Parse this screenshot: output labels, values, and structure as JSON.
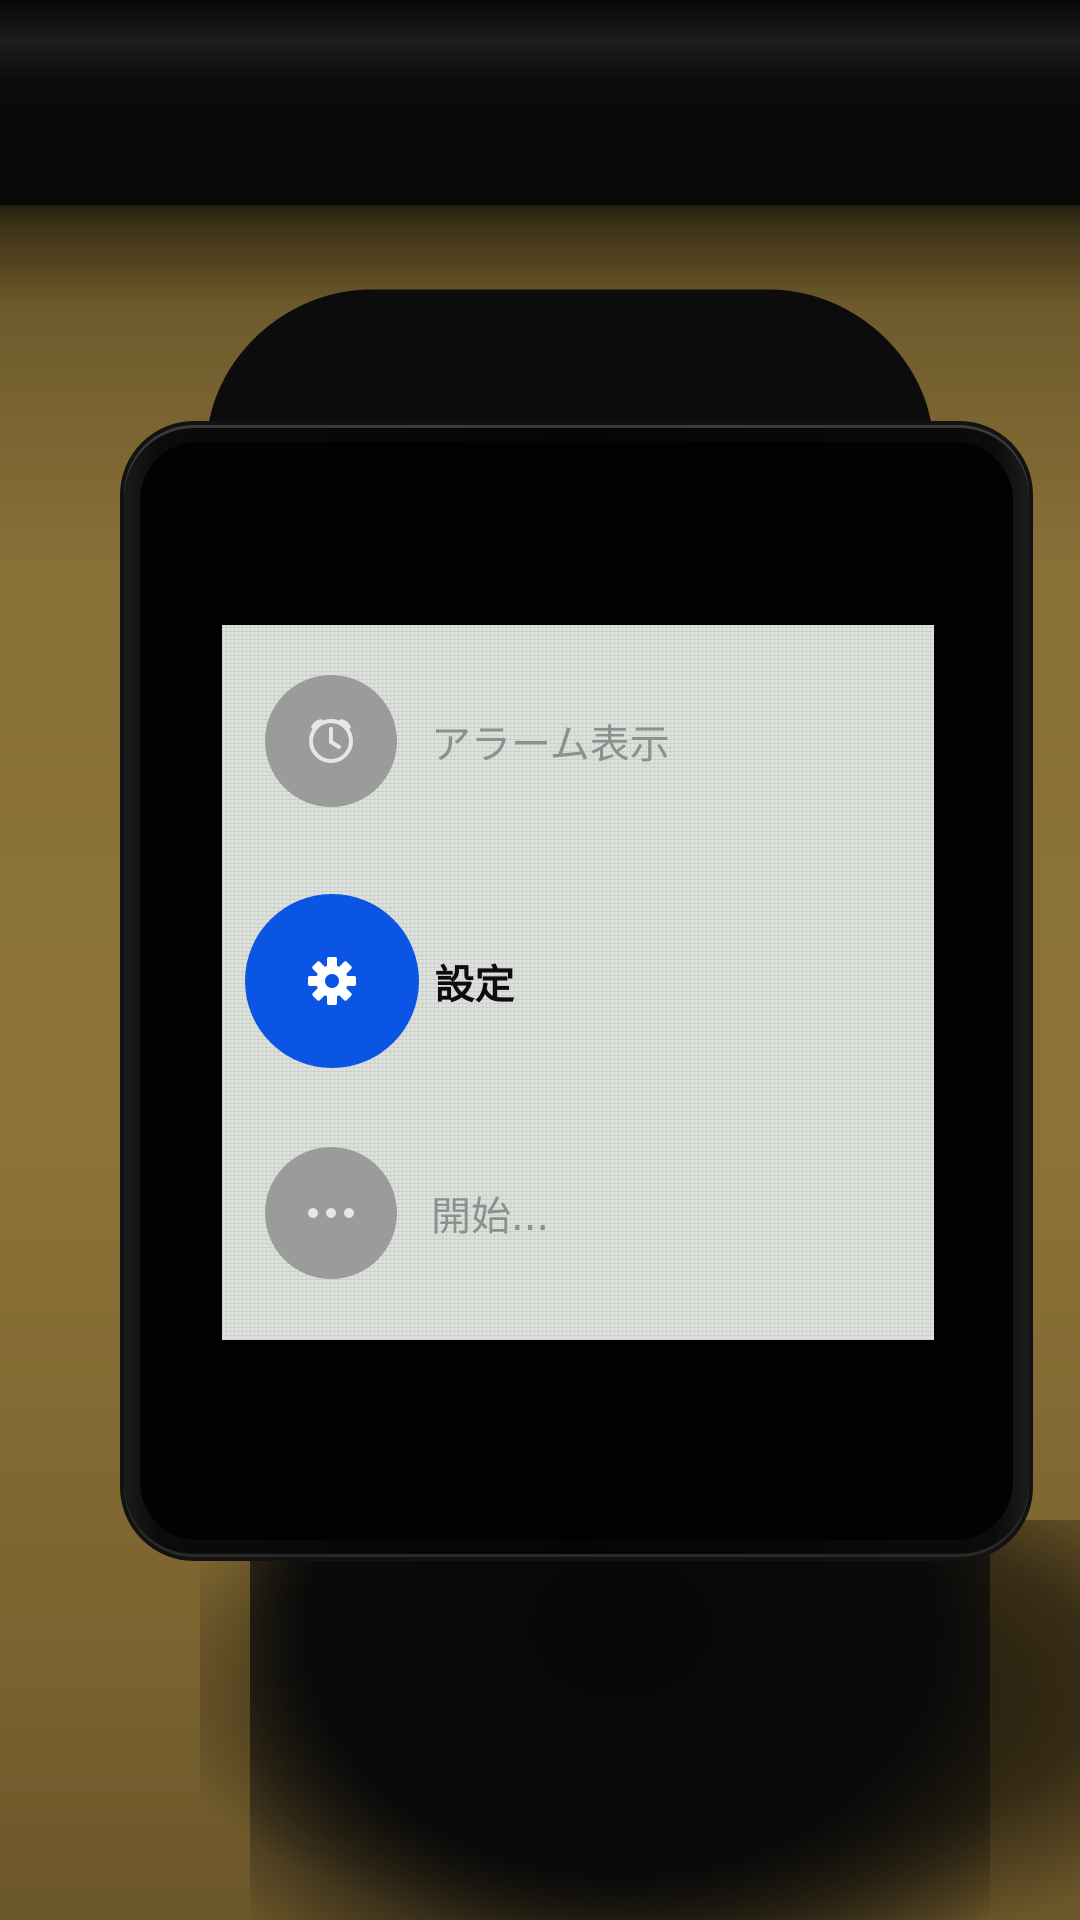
{
  "screen": {
    "menu": {
      "items": [
        {
          "label": "アラーム表示",
          "icon": "alarm-clock-icon",
          "state": "inactive"
        },
        {
          "label": "設定",
          "icon": "gear-icon",
          "state": "selected"
        },
        {
          "label": "開始...",
          "icon": "more-dots-icon",
          "state": "inactive"
        }
      ]
    }
  },
  "colors": {
    "accent_selected": "#0a55e3",
    "inactive_circle": "#9a9c9a",
    "inactive_text": "#8d908d",
    "active_text": "#0d0d0d",
    "screen_background": "#dde2dd"
  }
}
